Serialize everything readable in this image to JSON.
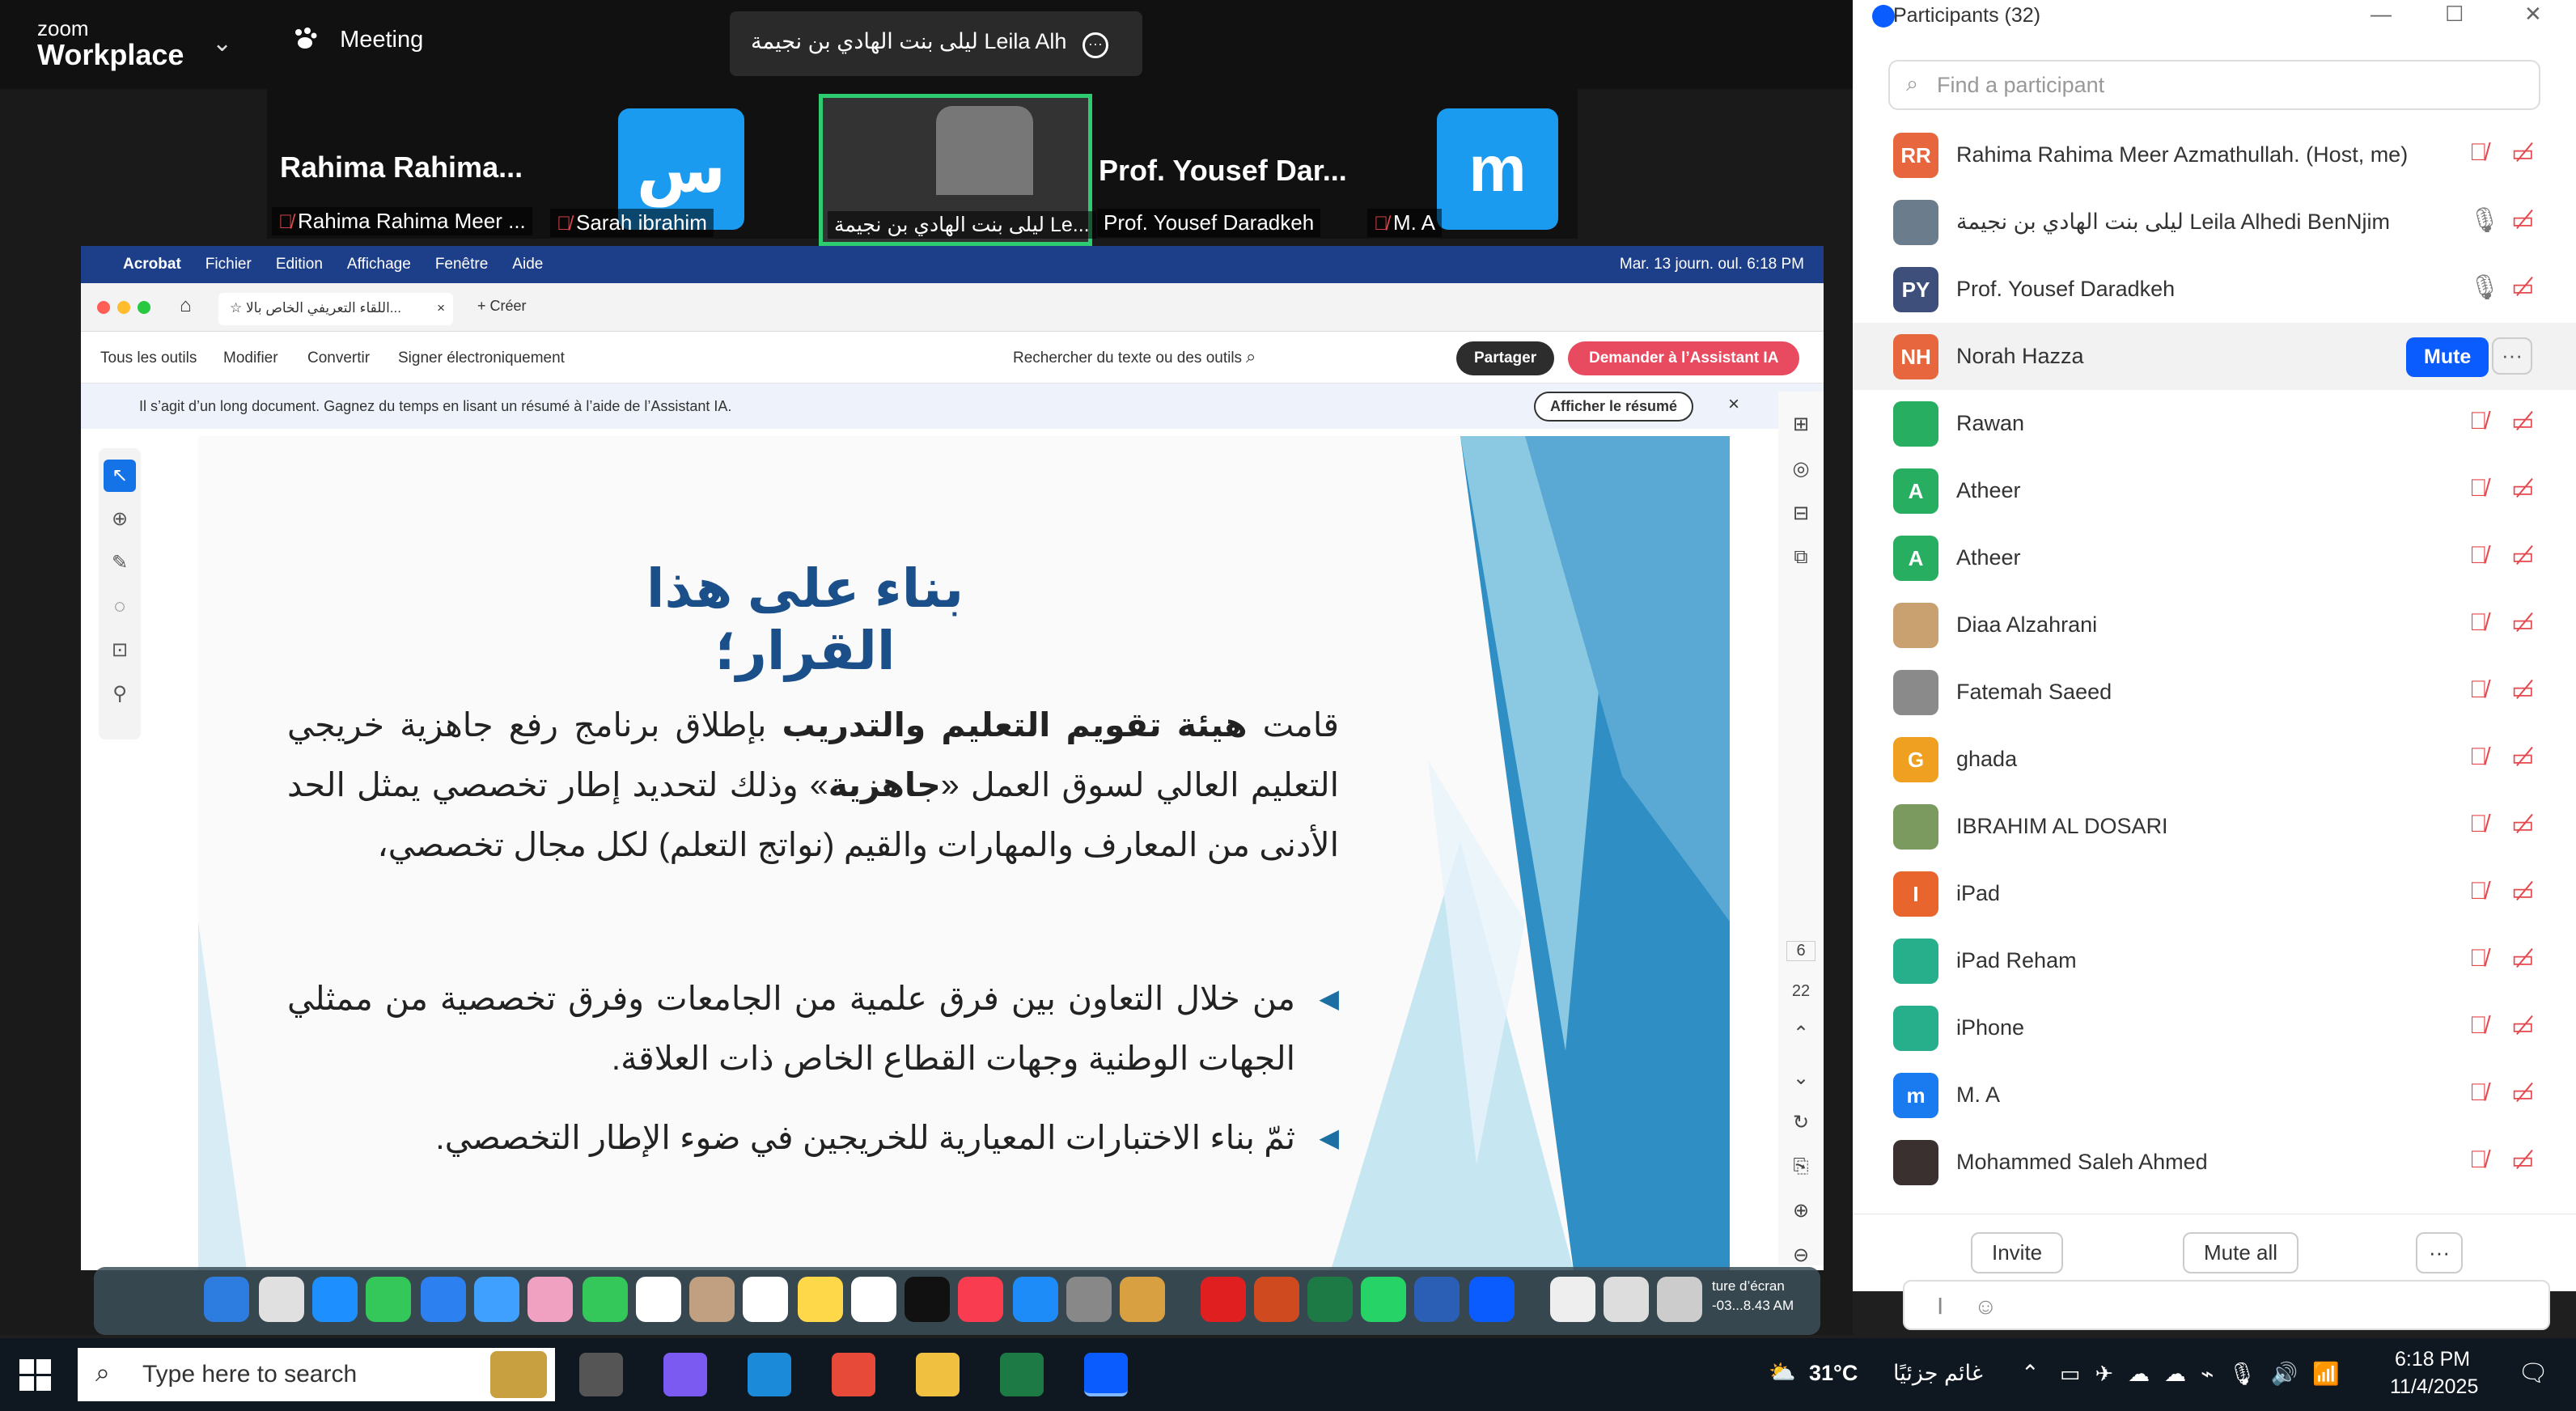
{
  "zoom": {
    "logo_small": "zoom",
    "logo_big": "Workplace",
    "chevron": "⌄",
    "meeting_label": "Meeting",
    "speaker_label": "ليلى بنت الهادي بن نجيمة Leila Alh",
    "tiles": [
      {
        "name": "Rahima  Rahima...",
        "sub": "Rahima Rahima Meer ...",
        "muted": true
      },
      {
        "avatar": "س",
        "color": "#1a9bf0",
        "sub": "Sarah ibrahim",
        "muted": true
      },
      {
        "sub": "ليلى بنت الهادي بن نجيمة Le...",
        "muted": false
      },
      {
        "name": "Prof. Yousef Dar...",
        "sub": "Prof. Yousef Daradkeh",
        "muted": false
      },
      {
        "avatar": "m",
        "color": "#1a9bf0",
        "sub": "M. A",
        "muted": true
      }
    ]
  },
  "mac": {
    "menu": [
      "Acrobat",
      "Fichier",
      "Edition",
      "Affichage",
      "Fenêtre",
      "Aide"
    ],
    "clock": "Mar. 13 journ. oul. 6:18 PM"
  },
  "acrobat": {
    "tab_title": "اللقاء التعريفي الخاص بالا...",
    "create": "Créer",
    "tools": [
      "Tous les outils",
      "Modifier",
      "Convertir",
      "Signer électroniquement"
    ],
    "search_label": "Rechercher du texte ou des outils",
    "share": "Partager",
    "ai": "Demander à l’Assistant IA",
    "banner_text": "Il s’agit d’un long document. Gagnez du temps en lisant un résumé à l’aide de l’Assistant IA.",
    "summary_btn": "Afficher le résumé",
    "page_current": "6",
    "page_total": "22"
  },
  "slide": {
    "title": "بناء على هذا القرار؛",
    "p1_pre": "قامت ",
    "p1_bold": "هيئة تقويم التعليم والتدريب",
    "p1_mid": " بإطلاق برنامج رفع جاهزية خريجي التعليم العالي لسوق العمل «",
    "p1_bold2": "جاهزية",
    "p1_post": "» وذلك لتحديد إطار تخصصي يمثل الحد الأدنى من المعارف والمهارات والقيم (نواتج التعلم) لكل مجال تخصصي،",
    "b1": "من خلال التعاون بين فرق علمية من الجامعات وفرق تخصصية من ممثلي الجهات الوطنية وجهات القطاع الخاص ذات العلاقة.",
    "b2": "ثمّ بناء الاختبارات المعيارية للخريجين في ضوء الإطار التخصصي."
  },
  "dock": {
    "caption_1": "ture d’écran",
    "caption_2": "-03...8.43 AM"
  },
  "participants": {
    "title": "Participants (32)",
    "search_placeholder": "Find a participant",
    "list": [
      {
        "initials": "RR",
        "color": "#e8663d",
        "name": "Rahima Rahima Meer Azmathullah. (Host, me)",
        "muted": true
      },
      {
        "initials": "",
        "color": "#6b7d8c",
        "name": "ليلى بنت الهادي بن نجيمة Leila Alhedi BenNjim",
        "muted": false
      },
      {
        "initials": "PY",
        "color": "#3d4f7a",
        "name": "Prof. Yousef Daradkeh",
        "muted": false
      },
      {
        "initials": "NH",
        "color": "#e8663d",
        "name": "Norah Hazza",
        "muted": false
      },
      {
        "initials": "",
        "color": "#27ae60",
        "name": "Rawan",
        "muted": true
      },
      {
        "initials": "A",
        "color": "#27ae60",
        "name": "Atheer",
        "muted": true
      },
      {
        "initials": "A",
        "color": "#27ae60",
        "name": "Atheer",
        "muted": true
      },
      {
        "initials": "",
        "color": "#c9a070",
        "name": "Diaa Alzahrani",
        "muted": true
      },
      {
        "initials": "",
        "color": "#8a8a8a",
        "name": "Fatemah Saeed",
        "muted": true
      },
      {
        "initials": "G",
        "color": "#f0a020",
        "name": "ghada",
        "muted": true
      },
      {
        "initials": "",
        "color": "#7a9a60",
        "name": "IBRAHIM AL DOSARI",
        "muted": true
      },
      {
        "initials": "I",
        "color": "#e8662d",
        "name": "iPad",
        "muted": true
      },
      {
        "initials": "",
        "color": "#27ae8a",
        "name": "iPad Reham",
        "muted": true
      },
      {
        "initials": "",
        "color": "#27ae8a",
        "name": "iPhone",
        "muted": true
      },
      {
        "initials": "m",
        "color": "#1a7af0",
        "name": "M. A",
        "muted": true
      },
      {
        "initials": "",
        "color": "#3a3030",
        "name": "Mohammed Saleh Ahmed",
        "muted": true
      }
    ],
    "mute_btn": "Mute",
    "more_btn": "···",
    "invite": "Invite",
    "mute_all": "Mute all"
  },
  "taskbar": {
    "search": "Type here to search",
    "weather": "31°C",
    "weather_text": "غائم جزئيًا",
    "time": "6:18 PM",
    "date": "11/4/2025"
  }
}
